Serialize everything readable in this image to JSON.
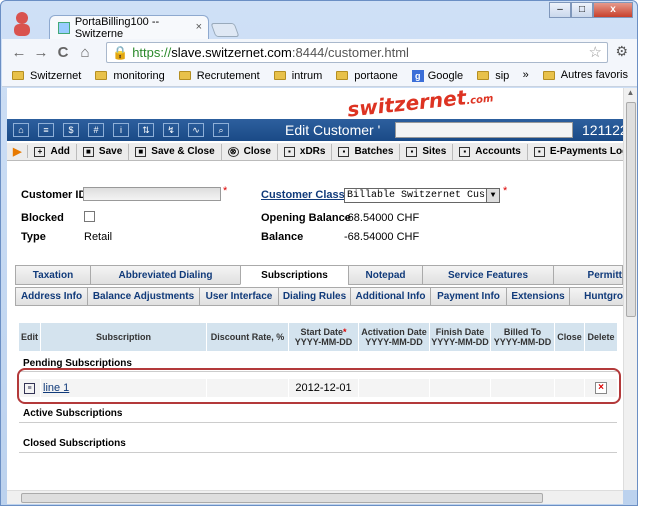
{
  "browser": {
    "tab_title": "PortaBilling100 -- Switzerne",
    "tab_close": "×",
    "minimize": "–",
    "maximize": "□",
    "close": "x",
    "url_https": "https://",
    "url_host": "slave.switzernet.com",
    "url_rest": ":8444/customer.html",
    "back_icon": "←",
    "forward_icon": "→",
    "reload_icon": "C",
    "home_icon": "⌂",
    "star_icon": "☆",
    "wrench_icon": "🔧",
    "bookmarks": [
      "Switzernet",
      "monitoring",
      "Recrutement",
      "intrum",
      "portaone",
      "Google",
      "sip"
    ],
    "other_bookmarks": "Autres favoris",
    "bm_more": "»"
  },
  "page": {
    "logo": "switzernet",
    "logo_suffix": ".com",
    "header_title": "Edit Customer '",
    "header_number": "121122",
    "actions": [
      {
        "label": "Add",
        "icon": "+"
      },
      {
        "label": "Save",
        "icon": "■"
      },
      {
        "label": "Save & Close",
        "icon": "■"
      },
      {
        "label": "Close",
        "icon": "⊗"
      },
      {
        "label": "xDRs",
        "icon": "▪"
      },
      {
        "label": "Batches",
        "icon": "▪"
      },
      {
        "label": "Sites",
        "icon": "▪"
      },
      {
        "label": "Accounts",
        "icon": "▪"
      },
      {
        "label": "E-Payments Log",
        "icon": "▪"
      }
    ],
    "customer_id_label": "Customer ID",
    "blocked_label": "Blocked",
    "type_label": "Type",
    "type_value": "Retail",
    "customer_class_label": "Customer Class",
    "customer_class_value": "Billable Switzernet Custo",
    "opening_balance_label": "Opening Balance",
    "opening_balance_value": "-68.54000 CHF",
    "balance_label": "Balance",
    "balance_value": "-68.54000 CHF",
    "required_mark": "*",
    "tabs_row1": [
      "Taxation",
      "Abbreviated Dialing",
      "Subscriptions",
      "Notepad",
      "Service Features",
      "Permitt"
    ],
    "tabs_row2": [
      "Address Info",
      "Balance Adjustments",
      "User Interface",
      "Dialing Rules",
      "Additional Info",
      "Payment Info",
      "Extensions",
      "Huntgro"
    ],
    "grid_headers": {
      "edit": "Edit",
      "subscription": "Subscription",
      "discount": "Discount Rate, %",
      "start_date": "Start Date",
      "start_fmt": "YYYY-MM-DD",
      "activation": "Activation Date",
      "activation_fmt": "YYYY-MM-DD",
      "finish": "Finish Date",
      "finish_fmt": "YYYY-MM-DD",
      "billed": "Billed To",
      "billed_fmt": "YYYY-MM-DD",
      "close": "Close",
      "delete": "Delete"
    },
    "pending_title": "Pending Subscriptions",
    "row": {
      "subscription": "line 1",
      "start_date": "2012-12-01"
    },
    "active_title": "Active Subscriptions",
    "closed_title": "Closed Subscriptions"
  },
  "colors": {
    "header_bg": "#1a4a86",
    "highlight": "#b3393a",
    "grid_header": "#d4e3ee"
  }
}
